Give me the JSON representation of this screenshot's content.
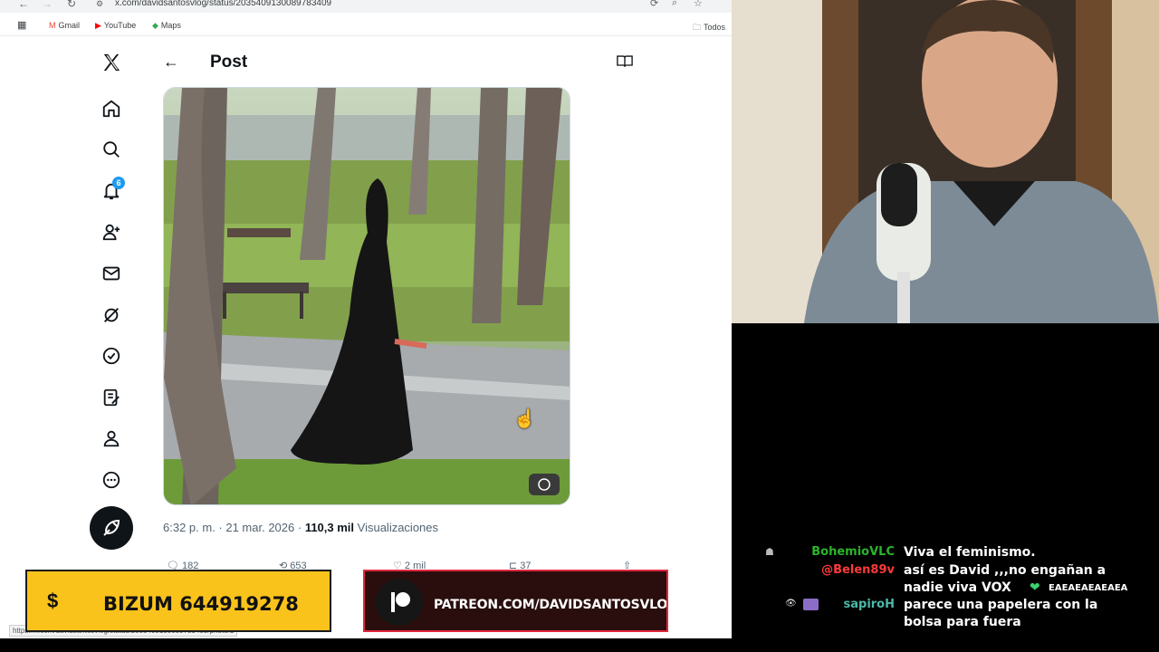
{
  "browser": {
    "url": "x.com/davidsantosvlog/status/2035409130089783409",
    "bookmarks": [
      {
        "label": "Gmail",
        "icon": "gmail-icon"
      },
      {
        "label": "YouTube",
        "icon": "youtube-icon"
      },
      {
        "label": "Maps",
        "icon": "maps-icon"
      }
    ],
    "all_bookmarks_label": "Todos",
    "status_url": "https://x.com/davidsantosvlog/status/2035409130089783409/photo/1"
  },
  "twitter": {
    "page_title": "Post",
    "notifications_count": "6",
    "post_time": "6:32 p. m. · 21 mar. 2026 · ",
    "views_count": "110,3 mil",
    "views_label": " Visualizaciones",
    "actions": {
      "replies": "182",
      "reposts": "653",
      "likes": "2 mil",
      "bookmarks": "37"
    }
  },
  "overlays": {
    "bizum_symbol": "$",
    "bizum_text": "BIZUM 644919278",
    "patreon_text": "PATREON.COM/DAVIDSANTOSVLOG"
  },
  "chat": {
    "messages": [
      {
        "user": "BohemioVLC",
        "user_color": "#2bb52b",
        "text": "Viva el feminismo."
      },
      {
        "user": "@Belen89v",
        "user_color": "#ff3a3a",
        "text": "así es David ,,,no engañan a"
      },
      {
        "user": "",
        "user_color": "#ffffff",
        "text": "nadie viva VOX"
      },
      {
        "user": "sapiroH",
        "user_color": "#4cb8a8",
        "text": "parece una papelera con la"
      },
      {
        "user": "",
        "user_color": "#ffffff",
        "text": "bolsa para fuera"
      }
    ],
    "emote_text": "EAEAEAEAEAEA"
  }
}
